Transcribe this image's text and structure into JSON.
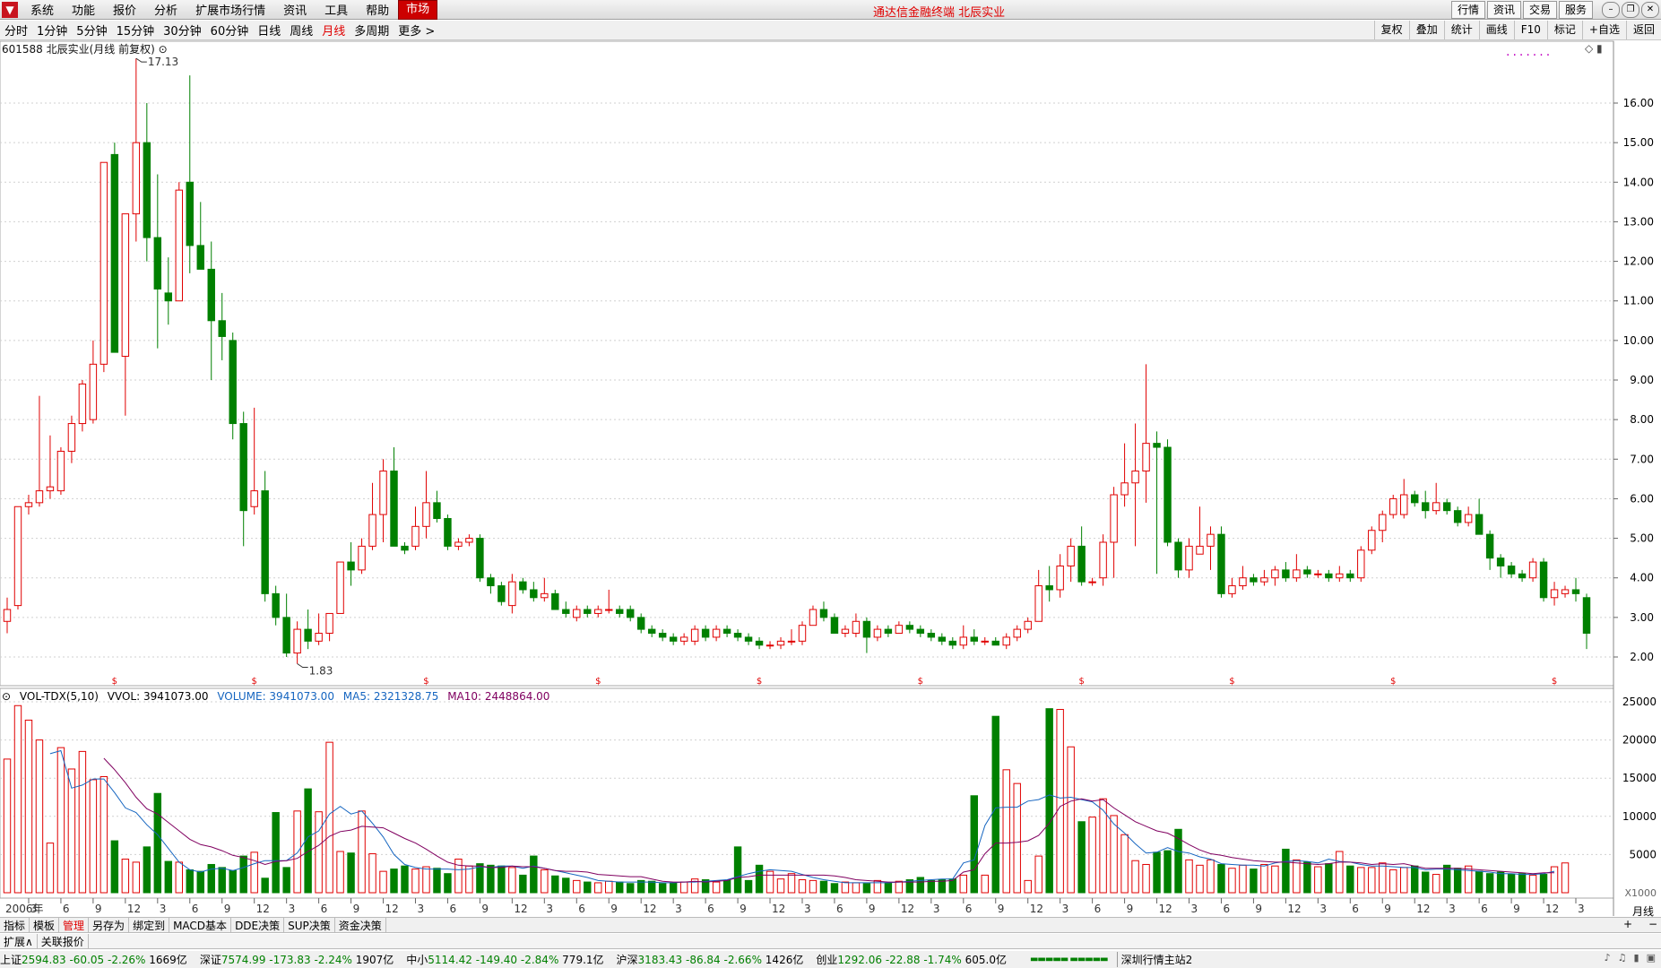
{
  "menubar": {
    "items": [
      "系统",
      "功能",
      "报价",
      "分析",
      "扩展市场行情",
      "资讯",
      "工具",
      "帮助",
      "市场"
    ],
    "active": "市场",
    "title": "通达信金融终端 北辰实业",
    "right": [
      "行情",
      "资讯",
      "交易",
      "服务"
    ]
  },
  "periods": {
    "items": [
      "分时",
      "1分钟",
      "5分钟",
      "15分钟",
      "30分钟",
      "60分钟",
      "日线",
      "周线",
      "月线",
      "多周期",
      "更多 >"
    ],
    "active": "月线"
  },
  "toolbar": [
    "复权",
    "叠加",
    "统计",
    "画线",
    "F10",
    "标记",
    "+自选",
    "返回"
  ],
  "stock": {
    "label": "601588 北辰实业(月线 前复权)",
    "high_label": "17.13",
    "low_label": "1.83"
  },
  "price_axis": [
    "16.00",
    "15.00",
    "14.00",
    "13.00",
    "12.00",
    "11.00",
    "10.00",
    "9.00",
    "8.00",
    "7.00",
    "6.00",
    "5.00",
    "4.00",
    "3.00",
    "2.00"
  ],
  "volume": {
    "name": "VOL-TDX(5,10)",
    "vvol": "VVOL: 3941073.00",
    "volume": "VOLUME: 3941073.00",
    "ma5": "MA5: 2321328.75",
    "ma10": "MA10: 2448864.00",
    "axis": [
      "25000",
      "20000",
      "15000",
      "10000",
      "5000"
    ],
    "unit": "X1000"
  },
  "x_axis": {
    "start": "2006年",
    "labels": [
      "3",
      "6",
      "9",
      "12",
      "3",
      "6",
      "9",
      "12",
      "3",
      "6",
      "9",
      "12",
      "3",
      "6",
      "9",
      "12",
      "3",
      "6",
      "9",
      "12",
      "3",
      "6",
      "9",
      "12",
      "3",
      "6",
      "9",
      "12",
      "3",
      "6",
      "9",
      "12",
      "3",
      "6",
      "9",
      "12",
      "3",
      "6",
      "9",
      "12",
      "3",
      "6",
      "9",
      "12",
      "3",
      "6",
      "9",
      "12",
      "3",
      "6",
      "9"
    ],
    "period": "月线"
  },
  "bottom_tabs": [
    "指标",
    "模板",
    "管理",
    "另存为",
    "绑定到",
    "MACD基本",
    "DDE决策",
    "SUP决策",
    "资金决策"
  ],
  "bottom_tabs_active": "管理",
  "sub_tabs": [
    "扩展∧",
    "关联报价"
  ],
  "zoom": [
    "+",
    "−"
  ],
  "status": [
    {
      "name": "上证",
      "value": "2594.83",
      "chg": "-60.05",
      "pct": "-2.26%",
      "amt": "1669亿"
    },
    {
      "name": "深证",
      "value": "7574.99",
      "chg": "-173.83",
      "pct": "-2.24%",
      "amt": "1907亿"
    },
    {
      "name": "中小",
      "value": "5114.42",
      "chg": "-149.40",
      "pct": "-2.84%",
      "amt": "779.1亿"
    },
    {
      "name": "沪深",
      "value": "3183.43",
      "chg": "-86.84",
      "pct": "-2.66%",
      "amt": "1426亿"
    },
    {
      "name": "创业",
      "value": "1292.06",
      "chg": "-22.88",
      "pct": "-1.74%",
      "amt": "605.0亿"
    }
  ],
  "server": "深圳行情主站2",
  "colors": {
    "up": "#e00000",
    "down": "#008000",
    "ma5": "#1565c0",
    "ma10": "#800060"
  },
  "chart_data": {
    "type": "candlestick",
    "title": "601588 北辰实业(月线 前复权)",
    "ylim": [
      1.8,
      17.2
    ],
    "candles": [
      [
        2.9,
        3.5,
        2.6,
        3.2
      ],
      [
        3.3,
        5.8,
        3.2,
        5.8
      ],
      [
        5.8,
        6.1,
        5.6,
        5.9
      ],
      [
        5.9,
        8.6,
        5.8,
        6.2
      ],
      [
        6.2,
        7.6,
        6.0,
        6.3
      ],
      [
        6.2,
        7.3,
        6.1,
        7.2
      ],
      [
        7.2,
        8.1,
        6.9,
        7.9
      ],
      [
        7.9,
        9.0,
        7.7,
        8.9
      ],
      [
        8.0,
        10.0,
        7.9,
        9.4
      ],
      [
        9.4,
        14.5,
        9.2,
        14.5
      ],
      [
        14.7,
        15.0,
        9.8,
        9.7
      ],
      [
        9.6,
        13.2,
        8.1,
        13.2
      ],
      [
        13.2,
        17.13,
        12.5,
        15.0
      ],
      [
        15.0,
        16.0,
        12.0,
        12.6
      ],
      [
        12.6,
        14.2,
        9.8,
        11.3
      ],
      [
        11.2,
        12.1,
        10.4,
        11.0
      ],
      [
        11.0,
        14.0,
        11.0,
        13.8
      ],
      [
        14.0,
        16.7,
        11.7,
        12.4
      ],
      [
        12.4,
        13.5,
        12.0,
        11.8
      ],
      [
        11.8,
        12.5,
        9.0,
        10.5
      ],
      [
        10.5,
        11.2,
        9.5,
        10.1
      ],
      [
        10.0,
        10.2,
        7.5,
        7.9
      ],
      [
        7.9,
        8.2,
        4.8,
        5.7
      ],
      [
        5.8,
        8.3,
        5.6,
        6.2
      ],
      [
        6.2,
        6.7,
        3.4,
        3.6
      ],
      [
        3.6,
        3.8,
        2.8,
        3.0
      ],
      [
        3.0,
        3.6,
        2.0,
        2.1
      ],
      [
        2.1,
        2.9,
        1.83,
        2.7
      ],
      [
        2.7,
        3.2,
        2.2,
        2.4
      ],
      [
        2.4,
        3.1,
        2.3,
        2.6
      ],
      [
        2.6,
        3.1,
        2.4,
        3.1
      ],
      [
        3.1,
        4.4,
        3.1,
        4.4
      ],
      [
        4.4,
        4.9,
        3.8,
        4.2
      ],
      [
        4.2,
        5.0,
        4.1,
        4.8
      ],
      [
        4.8,
        6.4,
        4.7,
        5.6
      ],
      [
        5.6,
        7.0,
        4.9,
        6.7
      ],
      [
        6.7,
        7.3,
        4.8,
        4.8
      ],
      [
        4.8,
        4.9,
        4.6,
        4.7
      ],
      [
        4.8,
        5.8,
        4.7,
        5.3
      ],
      [
        5.3,
        6.7,
        5.0,
        5.9
      ],
      [
        5.9,
        6.2,
        5.4,
        5.5
      ],
      [
        5.5,
        5.6,
        4.7,
        4.8
      ],
      [
        4.8,
        5.0,
        4.7,
        4.9
      ],
      [
        4.9,
        5.1,
        4.8,
        5.0
      ],
      [
        5.0,
        5.1,
        3.9,
        4.0
      ],
      [
        4.0,
        4.1,
        3.6,
        3.8
      ],
      [
        3.8,
        3.9,
        3.3,
        3.4
      ],
      [
        3.3,
        4.1,
        3.1,
        3.9
      ],
      [
        3.9,
        4.0,
        3.6,
        3.7
      ],
      [
        3.7,
        3.9,
        3.4,
        3.5
      ],
      [
        3.5,
        4.0,
        3.4,
        3.6
      ],
      [
        3.6,
        3.7,
        3.2,
        3.2
      ],
      [
        3.2,
        3.4,
        3.0,
        3.1
      ],
      [
        3.0,
        3.3,
        2.9,
        3.2
      ],
      [
        3.2,
        3.3,
        3.0,
        3.1
      ],
      [
        3.1,
        3.3,
        3.0,
        3.2
      ],
      [
        3.2,
        3.7,
        3.1,
        3.2
      ],
      [
        3.2,
        3.3,
        3.0,
        3.1
      ],
      [
        3.2,
        3.3,
        2.9,
        3.0
      ],
      [
        3.0,
        3.1,
        2.6,
        2.7
      ],
      [
        2.7,
        2.8,
        2.5,
        2.6
      ],
      [
        2.6,
        2.7,
        2.4,
        2.5
      ],
      [
        2.5,
        2.6,
        2.3,
        2.4
      ],
      [
        2.4,
        2.6,
        2.3,
        2.5
      ],
      [
        2.4,
        2.8,
        2.3,
        2.7
      ],
      [
        2.7,
        2.8,
        2.4,
        2.5
      ],
      [
        2.5,
        2.8,
        2.4,
        2.7
      ],
      [
        2.7,
        2.8,
        2.5,
        2.6
      ],
      [
        2.6,
        2.7,
        2.4,
        2.5
      ],
      [
        2.5,
        2.6,
        2.3,
        2.4
      ],
      [
        2.4,
        2.5,
        2.2,
        2.3
      ],
      [
        2.3,
        2.4,
        2.2,
        2.3
      ],
      [
        2.3,
        2.5,
        2.2,
        2.4
      ],
      [
        2.4,
        2.7,
        2.3,
        2.4
      ],
      [
        2.4,
        2.9,
        2.3,
        2.8
      ],
      [
        2.8,
        3.3,
        2.8,
        3.2
      ],
      [
        3.2,
        3.4,
        2.9,
        3.0
      ],
      [
        3.0,
        3.1,
        2.6,
        2.6
      ],
      [
        2.6,
        2.8,
        2.5,
        2.7
      ],
      [
        2.6,
        3.1,
        2.5,
        2.9
      ],
      [
        2.9,
        3.0,
        2.1,
        2.5
      ],
      [
        2.5,
        2.8,
        2.4,
        2.7
      ],
      [
        2.7,
        2.8,
        2.5,
        2.6
      ],
      [
        2.6,
        2.9,
        2.6,
        2.8
      ],
      [
        2.8,
        2.9,
        2.6,
        2.7
      ],
      [
        2.7,
        2.8,
        2.5,
        2.6
      ],
      [
        2.6,
        2.7,
        2.4,
        2.5
      ],
      [
        2.5,
        2.6,
        2.3,
        2.4
      ],
      [
        2.4,
        2.5,
        2.2,
        2.3
      ],
      [
        2.3,
        2.8,
        2.2,
        2.5
      ],
      [
        2.5,
        2.7,
        2.3,
        2.4
      ],
      [
        2.4,
        2.5,
        2.3,
        2.4
      ],
      [
        2.4,
        2.5,
        2.3,
        2.3
      ],
      [
        2.3,
        2.6,
        2.2,
        2.5
      ],
      [
        2.5,
        2.8,
        2.4,
        2.7
      ],
      [
        2.7,
        3.0,
        2.6,
        2.9
      ],
      [
        2.9,
        4.2,
        2.9,
        3.8
      ],
      [
        3.8,
        4.3,
        3.4,
        3.7
      ],
      [
        3.7,
        4.6,
        3.5,
        4.3
      ],
      [
        4.3,
        5.0,
        3.9,
        4.8
      ],
      [
        4.8,
        5.3,
        3.8,
        3.9
      ],
      [
        3.9,
        4.0,
        3.8,
        3.9
      ],
      [
        4.0,
        5.1,
        3.8,
        4.9
      ],
      [
        4.9,
        6.3,
        4.0,
        6.1
      ],
      [
        6.1,
        7.4,
        5.8,
        6.4
      ],
      [
        6.4,
        7.9,
        4.8,
        6.7
      ],
      [
        6.7,
        9.4,
        5.9,
        7.4
      ],
      [
        7.4,
        7.7,
        4.1,
        7.3
      ],
      [
        7.3,
        7.5,
        4.8,
        4.9
      ],
      [
        4.9,
        5.0,
        4.0,
        4.2
      ],
      [
        4.2,
        5.0,
        4.0,
        4.8
      ],
      [
        4.6,
        5.8,
        4.6,
        4.8
      ],
      [
        4.8,
        5.3,
        4.2,
        5.1
      ],
      [
        5.1,
        5.3,
        3.5,
        3.6
      ],
      [
        3.6,
        4.0,
        3.5,
        3.8
      ],
      [
        3.8,
        4.3,
        3.7,
        4.0
      ],
      [
        4.0,
        4.1,
        3.8,
        3.9
      ],
      [
        3.9,
        4.2,
        3.8,
        4.0
      ],
      [
        4.0,
        4.3,
        3.8,
        4.2
      ],
      [
        4.2,
        4.4,
        3.9,
        4.0
      ],
      [
        4.0,
        4.6,
        3.9,
        4.2
      ],
      [
        4.2,
        4.3,
        4.0,
        4.1
      ],
      [
        4.1,
        4.2,
        4.0,
        4.1
      ],
      [
        4.1,
        4.2,
        3.9,
        4.0
      ],
      [
        4.0,
        4.3,
        3.9,
        4.1
      ],
      [
        4.1,
        4.2,
        3.9,
        4.0
      ],
      [
        4.0,
        4.8,
        3.9,
        4.7
      ],
      [
        4.7,
        5.3,
        4.6,
        5.2
      ],
      [
        5.2,
        5.7,
        4.9,
        5.6
      ],
      [
        5.6,
        6.1,
        5.5,
        6.0
      ],
      [
        5.6,
        6.5,
        5.5,
        6.1
      ],
      [
        6.1,
        6.2,
        5.8,
        5.9
      ],
      [
        5.9,
        6.2,
        5.5,
        5.7
      ],
      [
        5.7,
        6.4,
        5.6,
        5.9
      ],
      [
        5.9,
        6.0,
        5.6,
        5.7
      ],
      [
        5.7,
        5.8,
        5.3,
        5.4
      ],
      [
        5.4,
        5.8,
        5.3,
        5.6
      ],
      [
        5.6,
        6.0,
        5.1,
        5.1
      ],
      [
        5.1,
        5.2,
        4.2,
        4.5
      ],
      [
        4.5,
        4.6,
        4.0,
        4.3
      ],
      [
        4.3,
        4.4,
        4.0,
        4.1
      ],
      [
        4.1,
        4.2,
        3.9,
        4.0
      ],
      [
        4.0,
        4.5,
        3.9,
        4.4
      ],
      [
        4.4,
        4.5,
        3.4,
        3.5
      ],
      [
        3.5,
        3.9,
        3.3,
        3.7
      ],
      [
        3.6,
        3.8,
        3.5,
        3.7
      ],
      [
        3.7,
        4.0,
        3.4,
        3.6
      ],
      [
        3.5,
        3.6,
        2.2,
        2.6
      ]
    ],
    "volume": [
      17500,
      24500,
      22600,
      20000,
      6500,
      19000,
      16200,
      18500,
      14800,
      15200,
      6800,
      4400,
      4000,
      6000,
      13000,
      4100,
      4000,
      3000,
      2800,
      3700,
      3300,
      2900,
      4800,
      5300,
      1900,
      10500,
      3300,
      10700,
      13600,
      10600,
      19700,
      5400,
      5200,
      10700,
      5100,
      2800,
      3100,
      3500,
      3100,
      3400,
      3200,
      2500,
      4400,
      3500,
      3800,
      3600,
      3500,
      3300,
      2300,
      4800,
      3000,
      2200,
      1900,
      1600,
      1400,
      1300,
      1500,
      1400,
      1200,
      1600,
      1500,
      1200,
      1300,
      1400,
      1800,
      1700,
      1400,
      1600,
      6000,
      1600,
      3600,
      2800,
      1800,
      2500,
      1700,
      1600,
      1500,
      1200,
      1400,
      1300,
      1200,
      1600,
      1300,
      1500,
      1700,
      2000,
      1600,
      1700,
      1800,
      2300,
      12700,
      2300,
      23100,
      16100,
      14300,
      1600,
      4800,
      24100,
      24000,
      19100,
      9300,
      9900,
      12300,
      10100,
      7600,
      4200,
      3700,
      5300,
      5500,
      8300,
      4300,
      3600,
      4300,
      3700,
      3200,
      3600,
      3100,
      3700,
      3500,
      5700,
      4300,
      4000,
      3400,
      3800,
      5400,
      3500,
      3300,
      3300,
      3900,
      3000,
      3300,
      3500,
      2700,
      2400,
      3600,
      3200,
      3500,
      2800,
      2500,
      2700,
      2400,
      2500,
      2300,
      2400,
      3400,
      3900
    ],
    "ma5": [
      null,
      null,
      null,
      null,
      18200,
      18600,
      13700,
      14100,
      14900,
      14900,
      13100,
      11100,
      10500,
      8900,
      7600,
      5800,
      4000,
      3000,
      2700,
      3100,
      3200,
      2900,
      3300,
      3800,
      4200,
      4200,
      4200,
      5200,
      7300,
      8100,
      10300,
      11300,
      10300,
      10700,
      9100,
      7300,
      5000,
      3700,
      3300,
      3100,
      3100,
      3100,
      3000,
      3100,
      3400,
      3300,
      3500,
      3500,
      3200,
      3500,
      3200,
      2900,
      2600,
      2300,
      2000,
      1600,
      1500,
      1400,
      1400,
      1400,
      1400,
      1300,
      1300,
      1400,
      1400,
      1500,
      1600,
      1700,
      2100,
      2500,
      2800,
      3000,
      2900,
      2800,
      2400,
      2000,
      1700,
      1500,
      1300,
      1300,
      1300,
      1300,
      1300,
      1400,
      1500,
      1600,
      1700,
      1800,
      1800,
      3900,
      4300,
      8800,
      11100,
      11200,
      11200,
      12000,
      12200,
      12800,
      12400,
      12500,
      12200,
      11900,
      10800,
      9000,
      7800,
      6400,
      5200,
      5300,
      5900,
      5400,
      5200,
      4700,
      4400,
      3800,
      3700,
      3600,
      3600,
      3500,
      3900,
      4100,
      4200,
      4100,
      3900,
      4400,
      4100,
      4000,
      3700,
      3500,
      3500,
      3400,
      3300,
      3300,
      3000,
      3100,
      3100,
      3000,
      2900,
      2800,
      2700,
      2500,
      2500,
      2400,
      2400,
      2500,
      2800
    ],
    "ma10": [
      null,
      null,
      null,
      null,
      null,
      null,
      null,
      null,
      null,
      17600,
      16100,
      14400,
      12500,
      11000,
      10300,
      9200,
      8100,
      7000,
      6300,
      6000,
      5500,
      4900,
      4600,
      4200,
      3700,
      4100,
      4200,
      4500,
      5400,
      6200,
      7400,
      8000,
      8200,
      8700,
      8600,
      8500,
      7800,
      7100,
      6500,
      5700,
      4800,
      4000,
      3600,
      3500,
      3500,
      3300,
      3300,
      3500,
      3400,
      3400,
      3200,
      2900,
      2800,
      2800,
      2700,
      2400,
      2300,
      2200,
      2100,
      2100,
      1800,
      1500,
      1400,
      1400,
      1500,
      1400,
      1500,
      1600,
      2000,
      2100,
      2300,
      2300,
      2300,
      2300,
      2300,
      2300,
      2300,
      2200,
      2000,
      1700,
      1600,
      1500,
      1400,
      1400,
      1400,
      1400,
      1500,
      1500,
      1600,
      2700,
      3000,
      5100,
      6500,
      6500,
      6600,
      6800,
      7500,
      9100,
      11300,
      12000,
      12300,
      12000,
      12200,
      11100,
      10200,
      9300,
      8700,
      8100,
      7800,
      7100,
      6300,
      5600,
      5100,
      4900,
      4600,
      4400,
      4200,
      4100,
      4000,
      4000,
      3900,
      3800,
      3700,
      3800,
      4000,
      4000,
      3900,
      3700,
      3800,
      3700,
      3800,
      3500,
      3200,
      3200,
      3200,
      3200,
      3100,
      3000,
      2900,
      2800,
      2700,
      2600,
      2500,
      2600,
      2600
    ]
  }
}
